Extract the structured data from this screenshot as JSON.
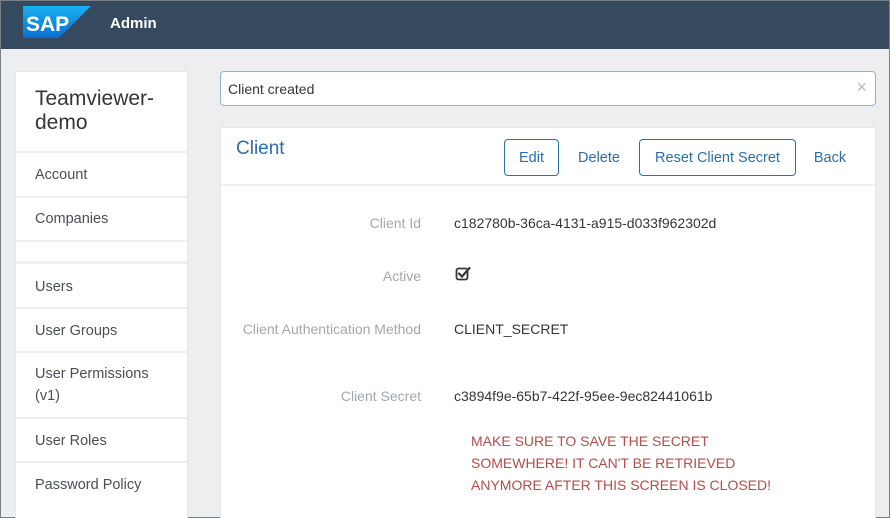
{
  "header": {
    "logo_text": "SAP",
    "app_title": "Admin"
  },
  "sidebar": {
    "tenant_name": "Teamviewer-demo",
    "items": [
      {
        "label": "Account"
      },
      {
        "label": "Companies"
      },
      {
        "label": ""
      },
      {
        "label": "Users"
      },
      {
        "label": "User Groups"
      },
      {
        "label": "User Permissions (v1)"
      },
      {
        "label": "User Roles"
      },
      {
        "label": "Password Policy"
      }
    ]
  },
  "notification": {
    "message": "Client created",
    "close_icon": "×"
  },
  "client": {
    "title": "Client",
    "actions": {
      "edit": "Edit",
      "delete": "Delete",
      "reset_secret": "Reset Client Secret",
      "back": "Back"
    },
    "fields": {
      "client_id_label": "Client Id",
      "client_id_value": "c182780b-36ca-4131-a915-d033f962302d",
      "active_label": "Active",
      "active_value": true,
      "auth_method_label": "Client Authentication Method",
      "auth_method_value": "CLIENT_SECRET",
      "secret_label": "Client Secret",
      "secret_value": "c3894f9e-65b7-422f-95ee-9ec82441061b"
    },
    "warning": "MAKE SURE TO SAVE THE SECRET SOMEWHERE! IT CAN'T BE RETRIEVED ANYMORE AFTER THIS SCREEN IS CLOSED!"
  },
  "colors": {
    "header_bg": "#354a5f",
    "accent": "#2b6fa8",
    "warning": "#b34c4c",
    "sap_logo": "#0a6ed1"
  }
}
